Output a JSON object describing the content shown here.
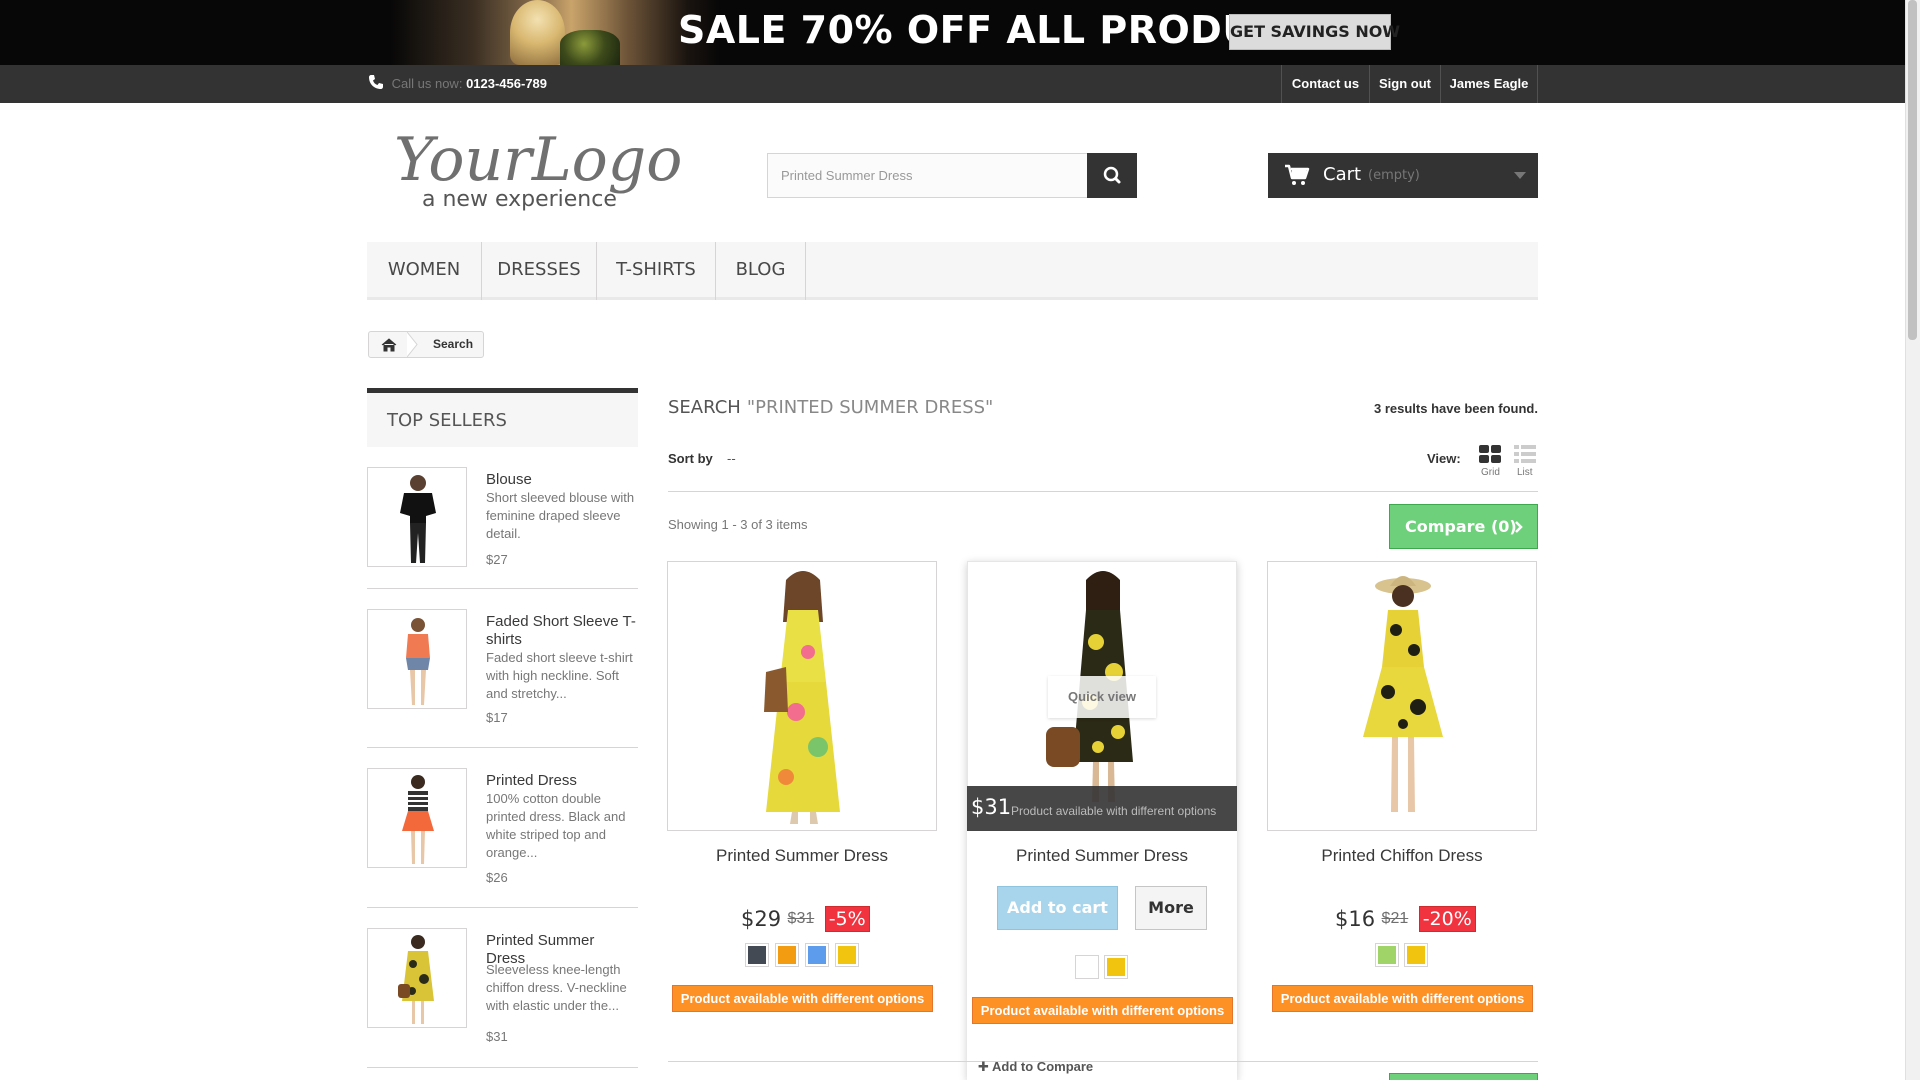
{
  "promo": {
    "text": "SALE 70% OFF ALL PRODUCTS",
    "button": "GET SAVINGS NOW"
  },
  "topbar": {
    "call_label": "Call us now:",
    "phone": "0123-456-789",
    "links": [
      "Contact us",
      "Sign out",
      "James Eagle"
    ]
  },
  "header": {
    "logo_text": "YourLogo",
    "logo_tagline": "a new experience",
    "search_value": "Printed Summer Dress",
    "cart_label": "Cart",
    "cart_status": "(empty)"
  },
  "menu": [
    "WOMEN",
    "DRESSES",
    "T-SHIRTS",
    "BLOG"
  ],
  "breadcrumb": {
    "current": "Search"
  },
  "sidebar": {
    "title": "TOP SELLERS",
    "items": [
      {
        "name": "Blouse",
        "desc": "Short sleeved blouse with feminine draped sleeve detail.",
        "price": "$27"
      },
      {
        "name": "Faded Short Sleeve T-shirts",
        "desc": "Faded short sleeve t-shirt with high neckline. Soft and stretchy...",
        "price": "$17"
      },
      {
        "name": "Printed Dress",
        "desc": "100% cotton double printed dress. Black and white striped top and orange...",
        "price": "$26"
      },
      {
        "name": "Printed Summer Dress",
        "desc": "Sleeveless knee-length chiffon dress. V-neckline with elastic under the...",
        "price": "$31"
      }
    ]
  },
  "results": {
    "title": "SEARCH",
    "term": "\"PRINTED SUMMER DRESS\"",
    "count_text": "3 results have been found.",
    "sort_label": "Sort by",
    "sort_value": "--",
    "view_label": "View:",
    "view_grid": "Grid",
    "view_list": "List",
    "showing": "Showing 1 - 3 of 3 items",
    "compare": "Compare (0)"
  },
  "products": [
    {
      "name": "Printed Summer Dress",
      "price": "$29",
      "old_price": "$31",
      "discount": "-5%",
      "swatches": [
        "#434a54",
        "#f39c11",
        "#5d9cec",
        "#f1c40f"
      ],
      "availability": "Product available with different options"
    },
    {
      "name": "Printed Summer Dress",
      "price": "$31",
      "overlay_note": "Product available with different options",
      "quick_view": "Quick view",
      "add_to_cart": "Add to cart",
      "more": "More",
      "swatches": [
        "#ffffff",
        "#f1c40f"
      ],
      "availability": "Product available with different options",
      "add_to_compare": "Add to Compare"
    },
    {
      "name": "Printed Chiffon Dress",
      "price": "$16",
      "old_price": "$21",
      "discount": "-20%",
      "swatches": [
        "#a0d468",
        "#f1c40f"
      ],
      "availability": "Product available with different options"
    }
  ]
}
